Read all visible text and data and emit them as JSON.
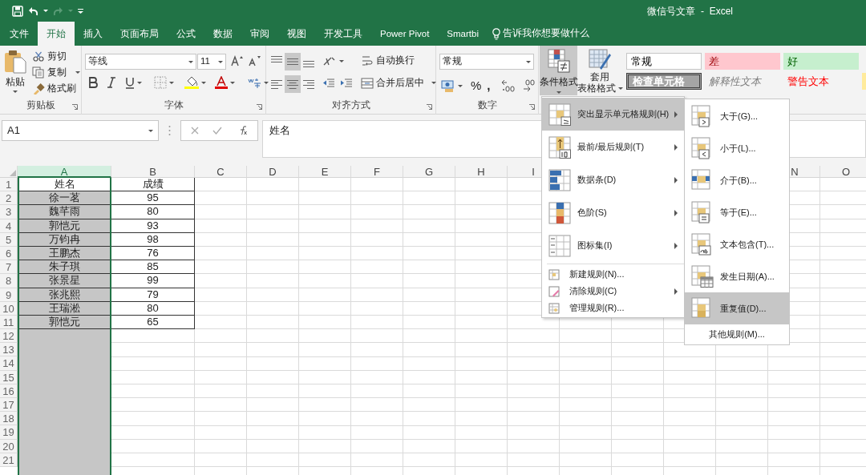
{
  "window": {
    "title": "微信号文章  -  Excel"
  },
  "tabs": [
    {
      "label": "文件",
      "selected": false
    },
    {
      "label": "开始",
      "selected": true
    },
    {
      "label": "插入",
      "selected": false
    },
    {
      "label": "页面布局",
      "selected": false
    },
    {
      "label": "公式",
      "selected": false
    },
    {
      "label": "数据",
      "selected": false
    },
    {
      "label": "审阅",
      "selected": false
    },
    {
      "label": "视图",
      "selected": false
    },
    {
      "label": "开发工具",
      "selected": false
    },
    {
      "label": "Power Pivot",
      "selected": false
    },
    {
      "label": "Smartbi",
      "selected": false
    }
  ],
  "tell_me": {
    "placeholder": "告诉我你想要做什么"
  },
  "ribbon": {
    "clipboard": {
      "paste": "粘贴",
      "cut": "剪切",
      "copy": "复制",
      "format_painter": "格式刷",
      "group_label": "剪贴板"
    },
    "font": {
      "font_name": "等线",
      "font_size": "11",
      "group_label": "字体"
    },
    "alignment": {
      "top_row": [
        {
          "kind": "top",
          "selected": false
        },
        {
          "kind": "middle",
          "selected": true
        },
        {
          "kind": "bottom",
          "selected": false
        }
      ],
      "bottom_row": [
        {
          "kind": "left",
          "selected": false
        },
        {
          "kind": "center",
          "selected": true
        },
        {
          "kind": "right",
          "selected": false
        }
      ],
      "wrap_text": "自动换行",
      "merge_center": "合并后居中",
      "group_label": "对齐方式"
    },
    "number": {
      "format": "常规",
      "percent": "%",
      "comma": ",",
      "group_label": "数字"
    },
    "conditional_formatting": {
      "label": "条件格式",
      "selected": true
    },
    "format_as_table": {
      "lines": [
        "套用",
        "表格格式"
      ]
    },
    "cell_styles": [
      {
        "label": "常规",
        "kind": "normal"
      },
      {
        "label": "差",
        "kind": "bad"
      },
      {
        "label": "好",
        "kind": "good"
      },
      {
        "label": "检查单元格",
        "kind": "check"
      },
      {
        "label": "解释性文本",
        "kind": "explanatory"
      },
      {
        "label": "警告文本",
        "kind": "warning"
      }
    ]
  },
  "formula_bar": {
    "name_box": "A1",
    "formula": "姓名"
  },
  "sheet": {
    "columns": [
      {
        "label": "A",
        "selected": true
      },
      {
        "label": "B",
        "selected": false
      },
      {
        "label": "C",
        "selected": false
      },
      {
        "label": "D",
        "selected": false
      },
      {
        "label": "E",
        "selected": false
      },
      {
        "label": "F",
        "selected": false
      },
      {
        "label": "G",
        "selected": false
      },
      {
        "label": "H",
        "selected": false
      },
      {
        "label": "I",
        "selected": false
      },
      {
        "label": "N",
        "selected": false
      },
      {
        "label": "O",
        "selected": false
      }
    ],
    "rows": [
      {
        "number": "1",
        "active": true,
        "cells": [
          "姓名",
          "成绩"
        ]
      },
      {
        "number": "2",
        "active": false,
        "cells": [
          "徐一茗",
          "95"
        ]
      },
      {
        "number": "3",
        "active": false,
        "cells": [
          "魏芊雨",
          "80"
        ]
      },
      {
        "number": "4",
        "active": false,
        "cells": [
          "郭恺元",
          "93"
        ]
      },
      {
        "number": "5",
        "active": false,
        "cells": [
          "万钧冉",
          "98"
        ]
      },
      {
        "number": "6",
        "active": false,
        "cells": [
          "王鹏杰",
          "76"
        ]
      },
      {
        "number": "7",
        "active": false,
        "cells": [
          "朱子琪",
          "85"
        ]
      },
      {
        "number": "8",
        "active": false,
        "cells": [
          "张景星",
          "99"
        ]
      },
      {
        "number": "9",
        "active": false,
        "cells": [
          "张兆熙",
          "79"
        ]
      },
      {
        "number": "10",
        "active": false,
        "cells": [
          "王瑞淞",
          "80"
        ]
      },
      {
        "number": "11",
        "active": false,
        "cells": [
          "郭恺元",
          "65"
        ]
      },
      {
        "number": "12",
        "active": false
      },
      {
        "number": "13",
        "active": false
      },
      {
        "number": "14",
        "active": false
      },
      {
        "number": "15",
        "active": false
      },
      {
        "number": "16",
        "active": false
      },
      {
        "number": "17",
        "active": false
      },
      {
        "number": "18",
        "active": false
      },
      {
        "number": "19",
        "active": false
      },
      {
        "number": "20",
        "active": false
      },
      {
        "number": "21",
        "active": false
      }
    ]
  },
  "menu": {
    "items": [
      {
        "label": "突出显示单元格规则(H)",
        "kind": "highlight",
        "submenu": true,
        "selected": true
      },
      {
        "label": "最前/最后规则(T)",
        "kind": "topbottom",
        "submenu": true,
        "selected": false
      },
      {
        "label": "数据条(D)",
        "kind": "databar",
        "submenu": true,
        "selected": false
      },
      {
        "label": "色阶(S)",
        "kind": "colorscale",
        "submenu": true,
        "selected": false
      },
      {
        "label": "图标集(I)",
        "kind": "iconset",
        "submenu": true,
        "selected": false
      },
      {
        "label": "新建规则(N)...",
        "kind": "new",
        "submenu": false,
        "selected": false
      },
      {
        "label": "清除规则(C)",
        "kind": "clear",
        "submenu": true,
        "selected": false
      },
      {
        "label": "管理规则(R)...",
        "kind": "manage",
        "submenu": false,
        "selected": false
      }
    ]
  },
  "submenu": {
    "items": [
      {
        "label": "大于(G)...",
        "kind": "greater",
        "selected": false
      },
      {
        "label": "小于(L)...",
        "kind": "less",
        "selected": false
      },
      {
        "label": "介于(B)...",
        "kind": "between",
        "selected": false
      },
      {
        "label": "等于(E)...",
        "kind": "equal",
        "selected": false
      },
      {
        "label": "文本包含(T)...",
        "kind": "text",
        "selected": false
      },
      {
        "label": "发生日期(A)...",
        "kind": "date",
        "selected": false
      },
      {
        "label": "重复值(D)...",
        "kind": "duplicate",
        "selected": true
      }
    ],
    "more": "其他规则(M)..."
  }
}
